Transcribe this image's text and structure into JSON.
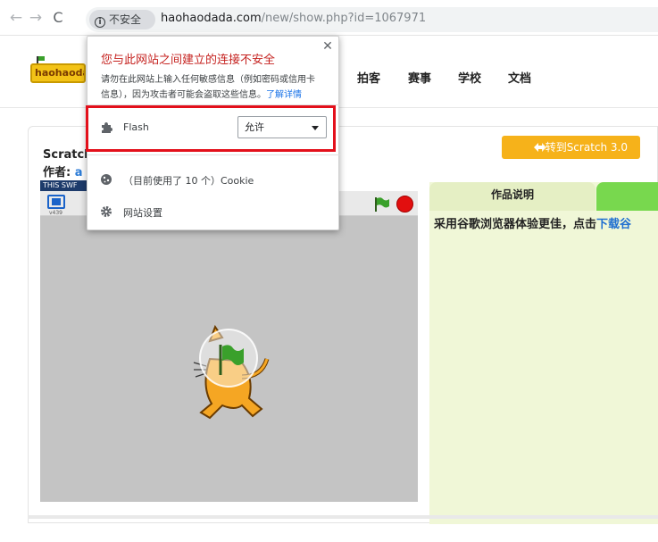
{
  "browser": {
    "security_label": "不安全",
    "url_host": "haohaodada.com",
    "url_path": "/new/show.php?id=1067971"
  },
  "site": {
    "logo_text": "haohaoda",
    "nav": [
      "拍客",
      "赛事",
      "学校",
      "文档"
    ]
  },
  "project": {
    "title_prefix": "Scratch",
    "author_label": "作者:",
    "author_initial": "a",
    "scratch3_button": "转到Scratch 3.0",
    "stage_strip_text": "THIS SWF",
    "version": "v439"
  },
  "description": {
    "tab_label": "作品说明",
    "text": "采用谷歌浏览器体验更佳，点击",
    "link": "下载谷"
  },
  "popup": {
    "heading": "您与此网站之间建立的连接不安全",
    "desc_line1": "请勿在此网站上输入任何敏感信息（例如密码或信用卡",
    "desc_line2": "信息），因为攻击者可能会盗取这些信息。",
    "learn_more": "了解详情",
    "flash_label": "Flash",
    "flash_value": "允许",
    "cookie_label": "（目前使用了 10 个）Cookie",
    "settings_label": "网站设置"
  },
  "colors": {
    "warning_red": "#c5221f",
    "highlight_red": "#e3101b",
    "link_blue": "#1a73e8",
    "scratch_orange": "#f6b21a",
    "panel_green": "#f0f7d7"
  },
  "icons": [
    "back-arrow-icon",
    "forward-arrow-icon",
    "reload-icon",
    "info-icon",
    "close-icon",
    "puzzle-icon",
    "cookie-icon",
    "gear-icon",
    "fullscreen-icon",
    "green-flag-icon",
    "stop-icon",
    "swap-icon"
  ]
}
